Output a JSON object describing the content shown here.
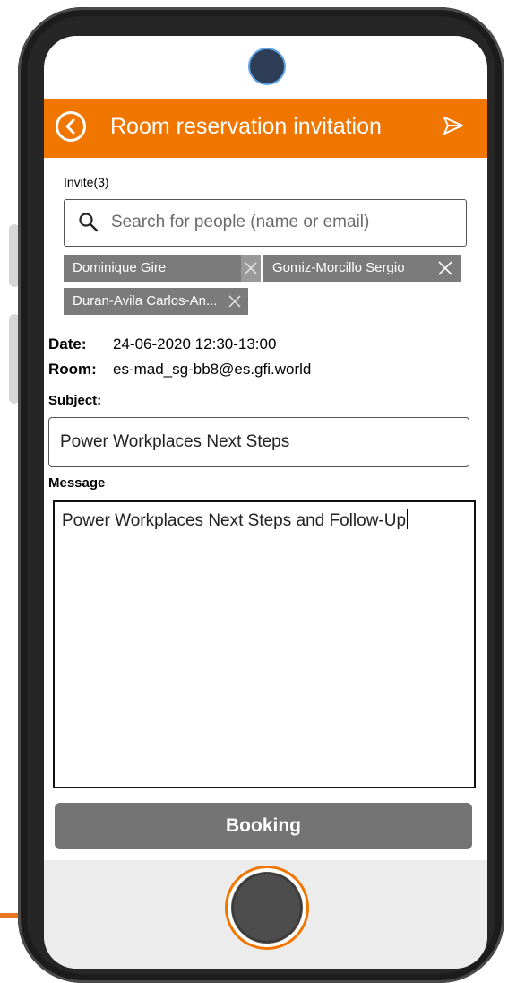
{
  "header": {
    "title": "Room reservation invitation"
  },
  "invite": {
    "label": "Invite(3)",
    "search_placeholder": "Search for people (name or email)",
    "chips": [
      "Dominique Gire",
      "Gomiz-Morcillo Sergio",
      "Duran-Avila Carlos-An..."
    ]
  },
  "details": {
    "date_key": "Date:",
    "date_value": "24-06-2020 12:30-13:00",
    "room_key": "Room:",
    "room_value": "es-mad_sg-bb8@es.gfi.world"
  },
  "subject": {
    "label": "Subject:",
    "value": "Power Workplaces Next Steps"
  },
  "message": {
    "label": "Message",
    "value": "Power Workplaces Next Steps and Follow-Up"
  },
  "booking": {
    "label": "Booking"
  },
  "icons": {
    "back": "back-arrow-icon",
    "send": "send-icon",
    "search": "search-icon",
    "remove": "close-icon"
  },
  "colors": {
    "accent": "#f07600",
    "chip": "#7b7b7b",
    "button": "#747474"
  }
}
